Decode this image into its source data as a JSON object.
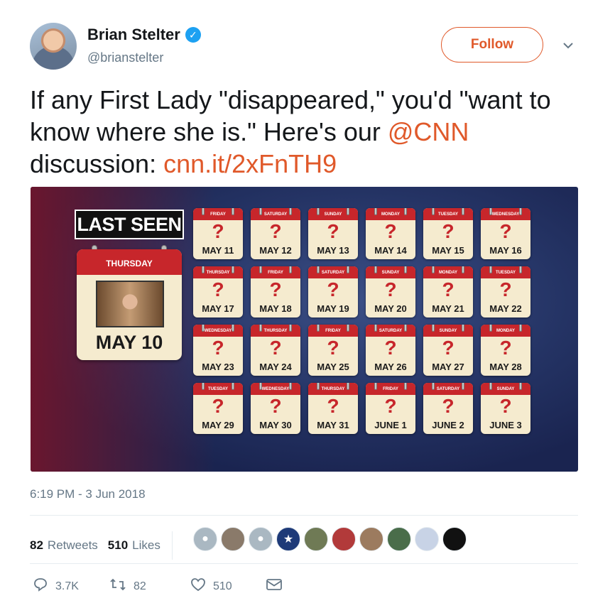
{
  "author": {
    "name": "Brian Stelter",
    "handle": "@brianstelter",
    "follow_label": "Follow"
  },
  "tweet": {
    "text_part1": "If any First Lady \"disappeared,\" you'd \"want to know where she is.\" Here's our ",
    "mention": "@CNN",
    "text_part2": " discussion: ",
    "link": "cnn.it/2xFnTH9"
  },
  "graphic": {
    "last_seen": "LAST SEEN",
    "main_day": "THURSDAY",
    "main_date": "MAY 10",
    "question_mark": "?",
    "days": [
      {
        "day": "FRIDAY",
        "date": "MAY 11"
      },
      {
        "day": "SATURDAY",
        "date": "MAY 12"
      },
      {
        "day": "SUNDAY",
        "date": "MAY 13"
      },
      {
        "day": "MONDAY",
        "date": "MAY 14"
      },
      {
        "day": "TUESDAY",
        "date": "MAY 15"
      },
      {
        "day": "WEDNESDAY",
        "date": "MAY 16"
      },
      {
        "day": "THURSDAY",
        "date": "MAY 17"
      },
      {
        "day": "FRIDAY",
        "date": "MAY 18"
      },
      {
        "day": "SATURDAY",
        "date": "MAY 19"
      },
      {
        "day": "SUNDAY",
        "date": "MAY 20"
      },
      {
        "day": "MONDAY",
        "date": "MAY 21"
      },
      {
        "day": "TUESDAY",
        "date": "MAY 22"
      },
      {
        "day": "WEDNESDAY",
        "date": "MAY 23"
      },
      {
        "day": "THURSDAY",
        "date": "MAY 24"
      },
      {
        "day": "FRIDAY",
        "date": "MAY 25"
      },
      {
        "day": "SATURDAY",
        "date": "MAY 26"
      },
      {
        "day": "SUNDAY",
        "date": "MAY 27"
      },
      {
        "day": "MONDAY",
        "date": "MAY 28"
      },
      {
        "day": "TUESDAY",
        "date": "MAY 29"
      },
      {
        "day": "WEDNESDAY",
        "date": "MAY 30"
      },
      {
        "day": "THURSDAY",
        "date": "MAY 31"
      },
      {
        "day": "FRIDAY",
        "date": "JUNE 1"
      },
      {
        "day": "SATURDAY",
        "date": "JUNE 2"
      },
      {
        "day": "SUNDAY",
        "date": "JUNE 3"
      }
    ]
  },
  "meta": {
    "timestamp": "6:19 PM - 3 Jun 2018",
    "retweets_count": "82",
    "retweets_label": "Retweets",
    "likes_count": "510",
    "likes_label": "Likes"
  },
  "actions": {
    "reply_count": "3.7K",
    "retweet_count": "82",
    "like_count": "510"
  },
  "colors": {
    "link": "#e0592a",
    "calendar_red": "#c7262b",
    "verified": "#1da1f2"
  }
}
